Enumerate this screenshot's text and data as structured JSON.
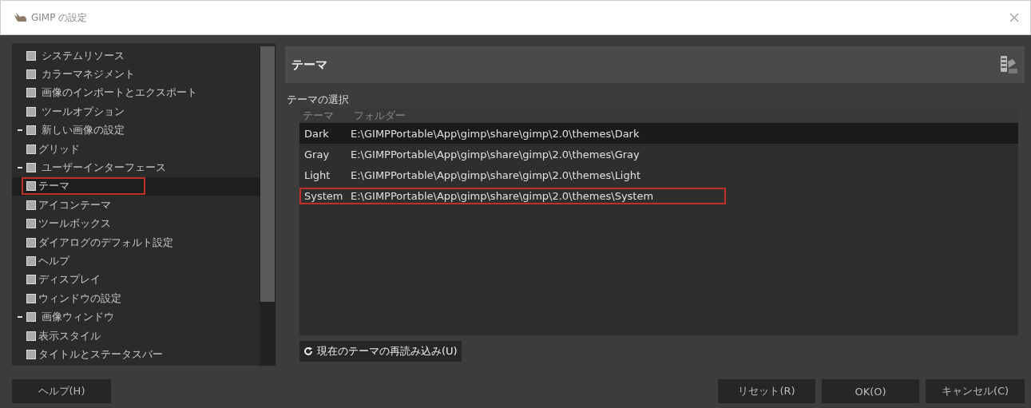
{
  "window": {
    "title": "GIMP の設定"
  },
  "sidebar": {
    "items": [
      {
        "label": "システムリソース",
        "selected": false,
        "marked": false
      },
      {
        "label": "カラーマネジメント",
        "selected": false,
        "marked": false
      },
      {
        "label": "画像のインポートとエクスポート",
        "selected": false,
        "marked": false
      },
      {
        "label": "ツールオプション",
        "selected": false,
        "marked": false
      },
      {
        "label": "新しい画像の設定",
        "selected": false,
        "marked": false,
        "expanded": true,
        "children": [
          {
            "label": "グリッド",
            "selected": false,
            "marked": false
          }
        ]
      },
      {
        "label": "ユーザーインターフェース",
        "selected": false,
        "marked": false,
        "expanded": true,
        "children": [
          {
            "label": "テーマ",
            "selected": true,
            "marked": true
          },
          {
            "label": "アイコンテーマ",
            "selected": false,
            "marked": false
          },
          {
            "label": "ツールボックス",
            "selected": false,
            "marked": false
          },
          {
            "label": "ダイアログのデフォルト設定",
            "selected": false,
            "marked": false
          },
          {
            "label": "ヘルプ",
            "selected": false,
            "marked": false
          },
          {
            "label": "ディスプレイ",
            "selected": false,
            "marked": false
          },
          {
            "label": "ウィンドウの設定",
            "selected": false,
            "marked": false
          }
        ]
      },
      {
        "label": "画像ウィンドウ",
        "selected": false,
        "marked": false,
        "expanded": true,
        "children": [
          {
            "label": "表示スタイル",
            "selected": false,
            "marked": false
          },
          {
            "label": "タイトルとステータスバー",
            "selected": false,
            "marked": false
          }
        ]
      }
    ]
  },
  "panel": {
    "title": "テーマ",
    "section": "テーマの選択",
    "table": {
      "columns": [
        "テーマ",
        "フォルダー"
      ],
      "rows": [
        {
          "name": "Dark",
          "folder": "E:\\GIMPPortable\\App\\gimp\\share\\gimp\\2.0\\themes\\Dark",
          "selected": true,
          "marked": false
        },
        {
          "name": "Gray",
          "folder": "E:\\GIMPPortable\\App\\gimp\\share\\gimp\\2.0\\themes\\Gray",
          "selected": false,
          "marked": false
        },
        {
          "name": "Light",
          "folder": "E:\\GIMPPortable\\App\\gimp\\share\\gimp\\2.0\\themes\\Light",
          "selected": false,
          "marked": false
        },
        {
          "name": "System",
          "folder": "E:\\GIMPPortable\\App\\gimp\\share\\gimp\\2.0\\themes\\System",
          "selected": false,
          "marked": true
        }
      ]
    },
    "reload_button": "現在のテーマの再読み込み(U)"
  },
  "buttons": {
    "help": "ヘルプ(H)",
    "reset": "リセット(R)",
    "ok": "OK(O)",
    "cancel": "キャンセル(C)"
  }
}
